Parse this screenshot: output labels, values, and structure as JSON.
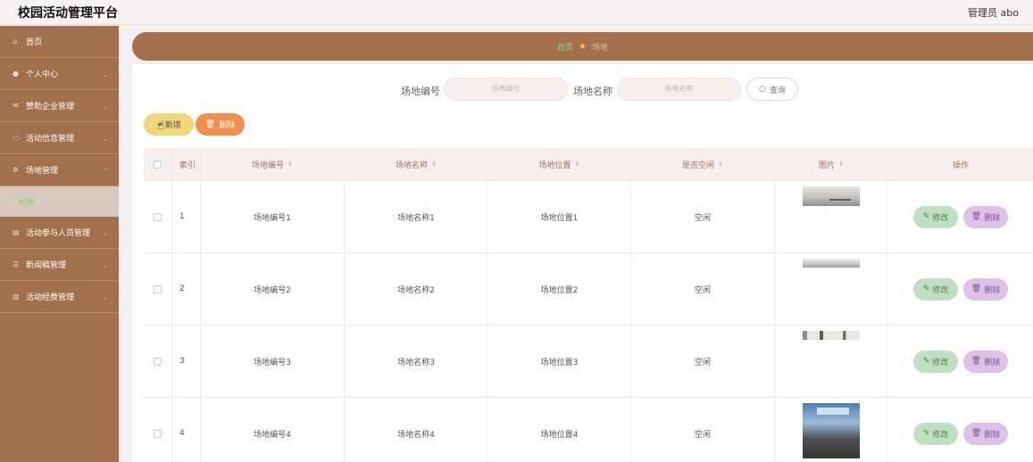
{
  "app": {
    "title": "校园活动管理平台",
    "user": "管理员 abo"
  },
  "sidebar": {
    "items": [
      {
        "label": "首页",
        "icon": "home-icon"
      },
      {
        "label": "个人中心",
        "icon": "user-icon"
      },
      {
        "label": "赞助企业管理",
        "icon": "mail-icon"
      },
      {
        "label": "活动信息管理",
        "icon": "check-circle-icon"
      },
      {
        "label": "场地管理",
        "icon": "gear-icon"
      },
      {
        "label": "活动参与人员管理",
        "icon": "list-icon"
      },
      {
        "label": "新闻稿管理",
        "icon": "sliders-icon"
      },
      {
        "label": "活动经费管理",
        "icon": "bank-icon"
      }
    ],
    "sub_item": "场地"
  },
  "breadcrumb": {
    "home": "首页",
    "current": "场地"
  },
  "search": {
    "code_label": "场地编号",
    "code_placeholder": "场地编号",
    "name_label": "场地名称",
    "name_placeholder": "场地名称",
    "query_label": "查询"
  },
  "actions": {
    "add": "新增",
    "delete": "删除"
  },
  "table": {
    "headers": [
      "索引",
      "场地编号",
      "场地名称",
      "场地位置",
      "是否空闲",
      "图片",
      "操作"
    ],
    "rows": [
      {
        "index": "1",
        "code": "场地编号1",
        "name": "场地名称1",
        "location": "场地位置1",
        "free": "空闲"
      },
      {
        "index": "2",
        "code": "场地编号2",
        "name": "场地名称2",
        "location": "场地位置2",
        "free": "空闲"
      },
      {
        "index": "3",
        "code": "场地编号3",
        "name": "场地名称3",
        "location": "场地位置3",
        "free": "空闲"
      },
      {
        "index": "4",
        "code": "场地编号4",
        "name": "场地名称4",
        "location": "场地位置4",
        "free": "空闲"
      }
    ],
    "edit_label": "修改",
    "delete_label": "删除"
  },
  "colors": {
    "sidebar": "#a2704c",
    "add_button": "#f0d77a",
    "delete_button": "#f28e4c",
    "edit_pill": "#bfe0bf",
    "delete_pill": "#dcc1e8"
  }
}
